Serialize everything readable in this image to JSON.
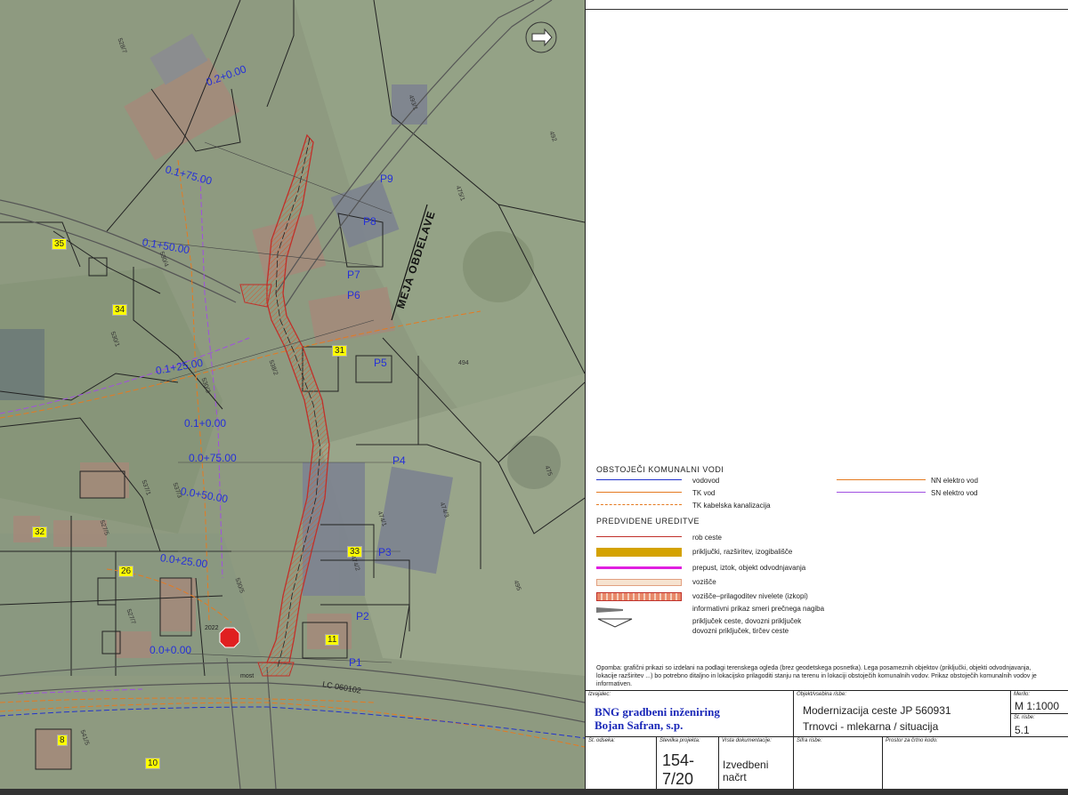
{
  "map": {
    "chainages": [
      "0.2+0.00",
      "0.1+75.00",
      "0.1+50.00",
      "0.1+25.00",
      "0.1+0.00",
      "0.0+75.00",
      "0.0+50.00",
      "0.0+25.00",
      "0.0+0.00"
    ],
    "points": [
      "P1",
      "P2",
      "P3",
      "P4",
      "P5",
      "P6",
      "P7",
      "P8",
      "P9"
    ],
    "house_numbers": [
      "35",
      "34",
      "31",
      "32",
      "11",
      "33",
      "10",
      "26",
      "8"
    ],
    "parcels": [
      "528/7",
      "530/4",
      "530/1",
      "530/3",
      "537/1",
      "537/3",
      "538/2",
      "474/1",
      "474/2",
      "474/3",
      "475",
      "494",
      "475/1",
      "493/1",
      "495",
      "492",
      "527/5",
      "541/5",
      "527/7",
      "530/5"
    ],
    "road_label": "LC 060102",
    "boundary_label": "MEJA OBDELAVE",
    "bridge_label": "most",
    "sign_label": "2022"
  },
  "legend": {
    "existing_title": "OBSTOJEČI KOMUNALNI VODI",
    "existing": [
      {
        "text": "vodovod",
        "color": "#2233cc"
      },
      {
        "text": "TK vod",
        "color": "#e57a20"
      },
      {
        "text": "TK kabelska kanalizacija",
        "color": "#e57a20"
      },
      {
        "text": "NN elektro vod",
        "color": "#e57a20"
      },
      {
        "text": "SN elektro vod",
        "color": "#a050e0"
      }
    ],
    "planned_title": "PREDVIDENE UREDITVE",
    "planned": [
      {
        "text": "rob ceste"
      },
      {
        "text": "priključki, razširitev, izogibališče"
      },
      {
        "text": "prepust, iztok, objekt odvodnjavanja"
      },
      {
        "text": "vozišče"
      },
      {
        "text": "vozišče–prilagoditev nivelete (izkopi)"
      },
      {
        "text": "informativni prikaz smeri prečnega nagiba"
      },
      {
        "text": "priključek ceste, dovozni priključek"
      }
    ],
    "planned_extra": "dovozni priključek, tirčev ceste"
  },
  "note": "Opomba: grafični prikazi so izdelani na podlagi terenskega ogleda (brez geodetskega posnetka). Lega posameznih objektov (priključki, objekti odvodnjavanja, lokacije razširitev ...) bo potrebno ditaljno in lokacijsko prilagoditi stanju na terenu in lokaciji obstoječih komunalnih vodov. Prikaz obstoječih komunalnih vodov je informativen.",
  "title_block": {
    "contractor_label": "Izvajalec:",
    "company_line1": "BNG gradbeni inženiring",
    "company_line2": "Bojan Safran, s.p.",
    "object_label": "Objekt/vsebina risbe:",
    "object_line1": "Modernizacija ceste JP 560931",
    "object_line2": "Trnovci - mlekarna / situacija",
    "scale_label": "Merilo:",
    "scale": "M 1:1000",
    "drawing_no_label": "Št. risbe:",
    "drawing_no": "5.1",
    "section_label": "Št. odseka:",
    "project_no_label": "Številka projekta:",
    "project_no": "154-7/20",
    "doc_type_label": "Vrsta dokumentacije:",
    "doc_type": "Izvedbeni načrt",
    "drawing_code_label": "Šifra risbe:",
    "code_label": "Prostor za črtno kodo:"
  }
}
